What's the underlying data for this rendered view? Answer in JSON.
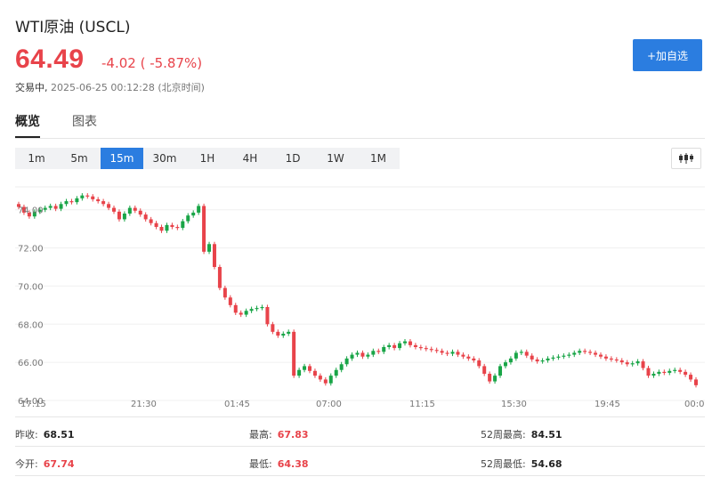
{
  "header": {
    "title": "WTI原油 (USCL)",
    "price": "64.49",
    "change": "-4.02 ( -5.87%)",
    "status_label": "交易中,",
    "timestamp": "2025-06-25 00:12:28 (北京时间)",
    "add_button": "+加自选"
  },
  "tabs": [
    {
      "label": "概览",
      "active": true
    },
    {
      "label": "图表",
      "active": false
    }
  ],
  "intervals": {
    "options": [
      "1m",
      "5m",
      "15m",
      "30m",
      "1H",
      "4H",
      "1D",
      "1W",
      "1M"
    ],
    "selected": "15m"
  },
  "colors": {
    "up": "#19a547",
    "down": "#e8434a",
    "accent": "#2b7de0"
  },
  "chart_data": {
    "type": "candlestick",
    "y_ticks": [
      "74.00",
      "72.00",
      "70.00",
      "68.00",
      "66.00",
      "64.00"
    ],
    "x_ticks": [
      "17:15",
      "21:30",
      "01:45",
      "07:00",
      "11:15",
      "15:30",
      "19:45",
      "00:00"
    ],
    "ylim": [
      64.0,
      75.2
    ],
    "grid": true,
    "close": [
      74.15,
      73.85,
      73.65,
      73.9,
      74.0,
      74.1,
      74.2,
      74.05,
      74.3,
      74.45,
      74.4,
      74.6,
      74.75,
      74.7,
      74.55,
      74.45,
      74.3,
      74.1,
      73.9,
      73.5,
      73.8,
      74.1,
      73.95,
      73.75,
      73.5,
      73.3,
      73.1,
      72.9,
      73.2,
      73.1,
      73.05,
      73.4,
      73.7,
      73.85,
      74.2,
      71.8,
      72.2,
      71.0,
      69.9,
      69.4,
      69.0,
      68.6,
      68.5,
      68.7,
      68.8,
      68.85,
      68.9,
      68.0,
      67.6,
      67.4,
      67.5,
      67.6,
      65.3,
      65.6,
      65.8,
      65.55,
      65.3,
      65.1,
      64.9,
      65.3,
      65.6,
      65.9,
      66.2,
      66.4,
      66.5,
      66.3,
      66.4,
      66.6,
      66.55,
      66.8,
      66.9,
      66.75,
      67.0,
      67.1,
      66.9,
      66.8,
      66.75,
      66.7,
      66.65,
      66.6,
      66.5,
      66.45,
      66.55,
      66.4,
      66.3,
      66.2,
      66.1,
      65.8,
      65.4,
      65.0,
      65.3,
      65.8,
      66.0,
      66.2,
      66.5,
      66.55,
      66.35,
      66.15,
      66.05,
      66.1,
      66.2,
      66.25,
      66.3,
      66.35,
      66.4,
      66.5,
      66.6,
      66.55,
      66.5,
      66.4,
      66.3,
      66.2,
      66.15,
      66.1,
      66.0,
      65.9,
      65.95,
      66.05,
      65.7,
      65.3,
      65.4,
      65.5,
      65.45,
      65.55,
      65.6,
      65.5,
      65.35,
      65.1,
      64.8
    ],
    "open_first": 74.3
  },
  "stats": [
    {
      "label": "昨收:",
      "value": "68.51",
      "color": "dark"
    },
    {
      "label": "最高:",
      "value": "67.83",
      "color": "red"
    },
    {
      "label": "52周最高:",
      "value": "84.51",
      "color": "dark"
    },
    {
      "label": "今开:",
      "value": "67.74",
      "color": "red"
    },
    {
      "label": "最低:",
      "value": "64.38",
      "color": "red"
    },
    {
      "label": "52周最低:",
      "value": "54.68",
      "color": "dark"
    }
  ]
}
